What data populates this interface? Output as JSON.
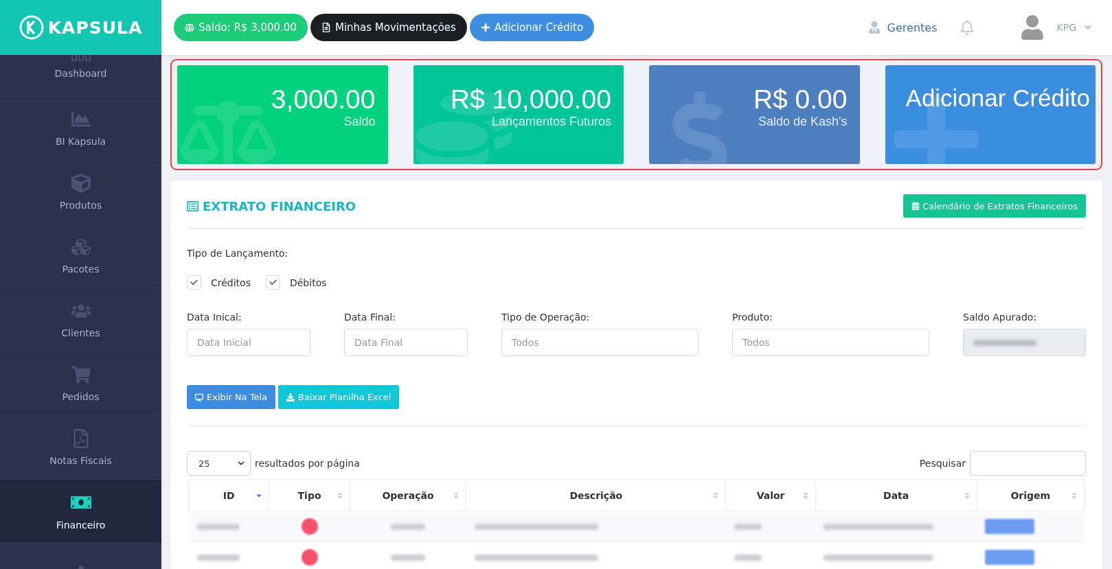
{
  "topbar": {
    "logo": "KAPSULA",
    "buttons": [
      {
        "label": "Saldo: R$ 3,000.00",
        "kind": "balance"
      },
      {
        "label": "Minhas Movimentações",
        "kind": "statement"
      },
      {
        "label": "Adicionar Crédito",
        "kind": "add"
      }
    ],
    "managers_link": "Gerentes",
    "user": "KPG"
  },
  "sidebar": {
    "items": [
      {
        "label": "Dashboard",
        "kind": "bars",
        "selected": false
      },
      {
        "label": "BI Kapsula",
        "kind": "chart",
        "selected": false
      },
      {
        "label": "Produtos",
        "kind": "cube",
        "selected": false
      },
      {
        "label": "Pacotes",
        "kind": "cubes",
        "selected": false
      },
      {
        "label": "Clientes",
        "kind": "users",
        "selected": false
      },
      {
        "label": "Pedidos",
        "kind": "cart",
        "selected": false
      },
      {
        "label": "Notas Fiscais",
        "kind": "pdf",
        "selected": false
      },
      {
        "label": "Financeiro",
        "kind": "money",
        "selected": true
      },
      {
        "kind": "gear",
        "selected": false
      }
    ]
  },
  "cards": [
    {
      "kind": "balance",
      "value": "3,000.00",
      "label": "Saldo"
    },
    {
      "kind": "future",
      "value": "R$ 10,000.00",
      "label": "Lançamentos Futuros"
    },
    {
      "kind": "kash",
      "value": "R$ 0.00",
      "label": "Saldo de Kash's"
    },
    {
      "kind": "add",
      "value": "Adicionar Crédito"
    }
  ],
  "panel": {
    "title": "EXTRATO FINANCEIRO",
    "calendar_button": "Calendário de Extratos Financeiros",
    "filter_label": "Tipo de Lançamento:",
    "checkboxes": [
      {
        "label": "Créditos",
        "checked": true
      },
      {
        "label": "Débitos",
        "checked": true
      }
    ],
    "fields": [
      {
        "label": "Data Inical:",
        "placeholder": "Data Inicial",
        "kind": "input"
      },
      {
        "label": "Data Final:",
        "placeholder": "Data Final",
        "kind": "input"
      },
      {
        "label": "Tipo de Operação:",
        "placeholder": "Todos",
        "kind": "input"
      },
      {
        "label": "Produto:",
        "placeholder": "Todos",
        "kind": "input"
      },
      {
        "label": "Saldo Apurado:",
        "kind": "redacted",
        "disabled": true
      }
    ],
    "actions": [
      {
        "label": "Exibir Na Tela",
        "kind": "screen"
      },
      {
        "label": "Baixar Planilha Excel",
        "kind": "download"
      }
    ],
    "page_size": "25",
    "page_size_label": "resultados por página",
    "search_label": "Pesquisar",
    "table": {
      "columns": [
        {
          "label": "ID",
          "sorted": true
        },
        {
          "label": "Tipo",
          "sorted": false
        },
        {
          "label": "Operação",
          "sorted": false
        },
        {
          "label": "Descrição",
          "sorted": false
        },
        {
          "label": "Valor",
          "sorted": false
        },
        {
          "label": "Data",
          "sorted": false
        },
        {
          "label": "Origem",
          "sorted": false
        }
      ],
      "rows": [
        {
          "kind": "redacted",
          "color": "#f4516c"
        },
        {
          "kind": "redacted",
          "color": "#f4516c"
        }
      ]
    }
  }
}
